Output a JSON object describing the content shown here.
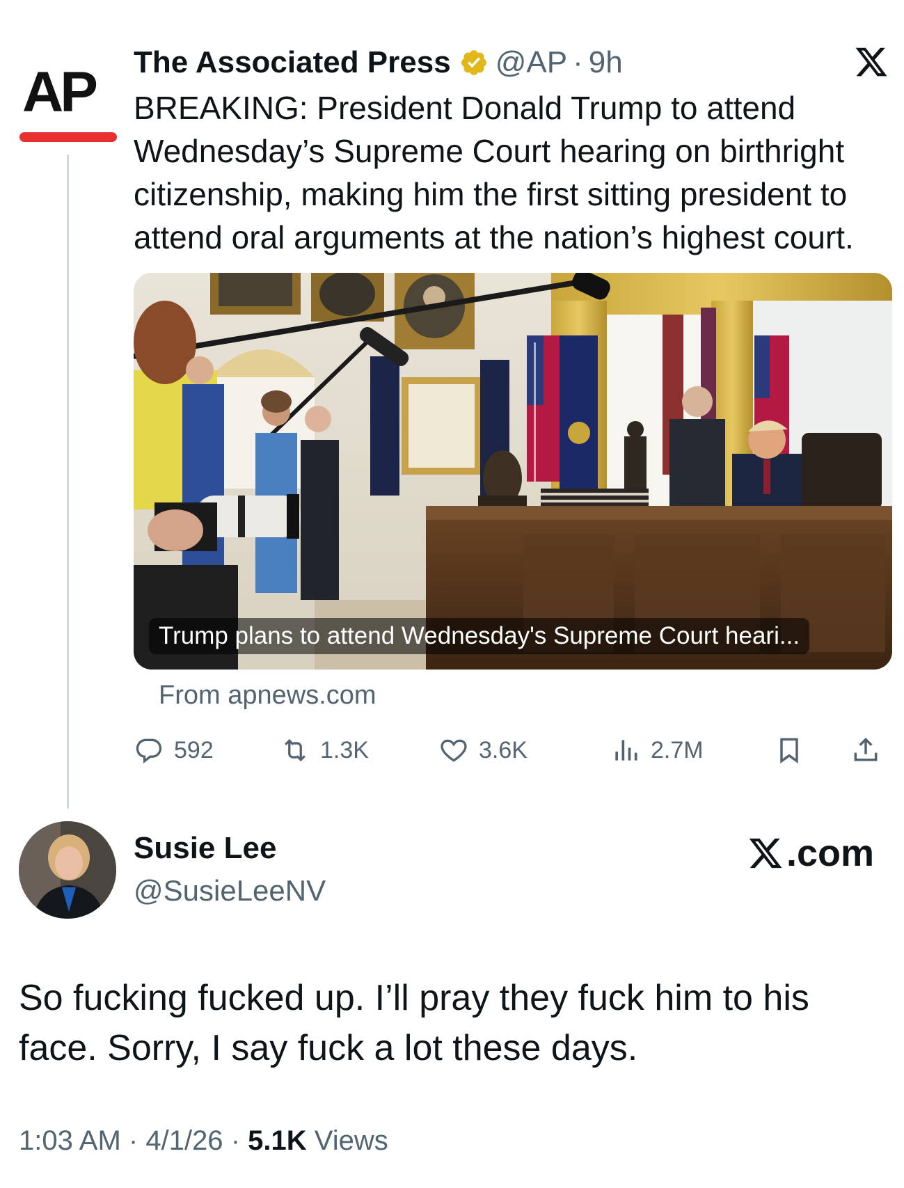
{
  "quoted_tweet": {
    "logo_text": "AP",
    "name": "The Associated Press",
    "handle": "@AP",
    "separator": "·",
    "time": "9h",
    "text": "BREAKING: President Donald Trump to attend Wednesday’s Supreme Court hearing on birthright citizenship, making him the first sitting president to attend oral arguments at the nation’s highest court.",
    "card_title": "Trump plans to attend Wednesday's Supreme Court heari...",
    "card_source": "From apnews.com",
    "stats": {
      "replies": "592",
      "reposts": "1.3K",
      "likes": "3.6K",
      "views": "2.7M"
    },
    "colors": {
      "logo_bar": "#e8312f",
      "verified_badge": "#e2b719"
    }
  },
  "tweet": {
    "name": "Susie Lee",
    "handle": "@SusieLeeNV",
    "watermark": ".com",
    "text": "So fucking fucked up.  I’ll pray they fuck him to his face. Sorry, I say fuck a lot these days.",
    "time": "1:03 AM",
    "date": "4/1/26",
    "separator": "·",
    "views_count": "5.1K",
    "views_label": "Views"
  },
  "icons": [
    "x-logo-icon",
    "verified-badge-icon",
    "reply-icon",
    "repost-icon",
    "like-icon",
    "views-icon",
    "bookmark-icon",
    "share-icon"
  ]
}
